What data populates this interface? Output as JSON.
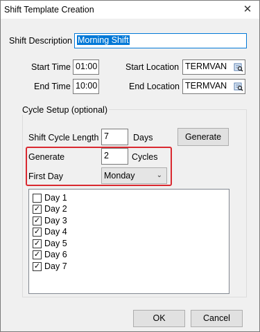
{
  "window": {
    "title": "Shift Template Creation",
    "close_glyph": "✕"
  },
  "shift_description": {
    "label": "Shift Description",
    "value": "Morning Shift"
  },
  "start_time": {
    "label": "Start Time",
    "value": "01:00"
  },
  "end_time": {
    "label": "End Time",
    "value": "10:00"
  },
  "start_location": {
    "label": "Start Location",
    "value": "TERMVAN",
    "icon": "lookup-icon"
  },
  "end_location": {
    "label": "End Location",
    "value": "TERMVAN",
    "icon": "lookup-icon"
  },
  "cycle_setup": {
    "label": "Cycle Setup (optional)",
    "cycle_length_label": "Shift Cycle Length",
    "cycle_length_value": "7",
    "cycle_length_unit": "Days",
    "generate_button": "Generate",
    "generate_label": "Generate",
    "generate_value": "2",
    "generate_unit": "Cycles",
    "first_day_label": "First Day",
    "first_day_value": "Monday",
    "highlight_color": "#d9282f"
  },
  "days": [
    {
      "label": "Day 1",
      "checked": false
    },
    {
      "label": "Day 2",
      "checked": true
    },
    {
      "label": "Day 3",
      "checked": true
    },
    {
      "label": "Day 4",
      "checked": true
    },
    {
      "label": "Day 5",
      "checked": true
    },
    {
      "label": "Day 6",
      "checked": true
    },
    {
      "label": "Day 7",
      "checked": true
    }
  ],
  "footer": {
    "ok_label": "OK",
    "cancel_label": "Cancel"
  }
}
